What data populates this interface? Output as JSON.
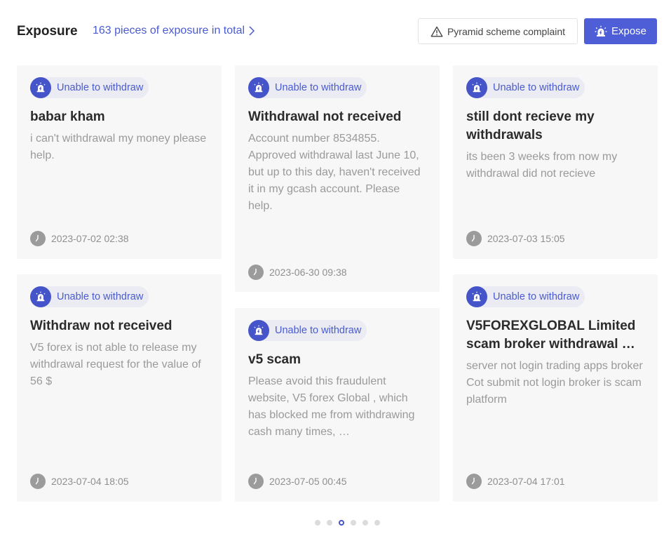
{
  "header": {
    "title": "Exposure",
    "total_link": "163 pieces of exposure in total",
    "complaint_button": "Pyramid scheme complaint",
    "expose_button": "Expose"
  },
  "cards": [
    {
      "badge": "Unable to withdraw",
      "title": "babar kham",
      "text": "i can't withdrawal my money please help.",
      "date": "2023-07-02 02:38"
    },
    {
      "badge": "Unable to withdraw",
      "title": "Withdrawal not received",
      "text": "Account number 8534855. Approved withdrawal last June 10, but up to this day, haven't received it in my gcash account. Please help.",
      "date": "2023-06-30 09:38"
    },
    {
      "badge": "Unable to withdraw",
      "title": "still dont recieve my withdrawals",
      "text": "its been 3 weeks from now my withdrawal did not recieve",
      "date": "2023-07-03 15:05"
    },
    {
      "badge": "Unable to withdraw",
      "title": "Withdraw not received",
      "text": "V5 forex is not able to release my withdrawal request for the value of 56 $",
      "date": "2023-07-04 18:05"
    },
    {
      "badge": "Unable to withdraw",
      "title": "v5 scam",
      "text": "Please avoid this fraudulent website, V5 forex Global , which has blocked me from withdrawing cash many times, …",
      "date": "2023-07-05 00:45"
    },
    {
      "badge": "Unable to withdraw",
      "title": "V5FOREXGLOBAL Limited scam broker withdrawal …",
      "text": "server not login trading apps broker Cot submit not login broker is scam platform",
      "date": "2023-07-04 17:01"
    }
  ],
  "pagination": {
    "total": 6,
    "active": 3
  },
  "colors": {
    "accent": "#4d5ed6",
    "badge_bg": "#eaebf3",
    "card_bg": "#f7f7f7"
  }
}
